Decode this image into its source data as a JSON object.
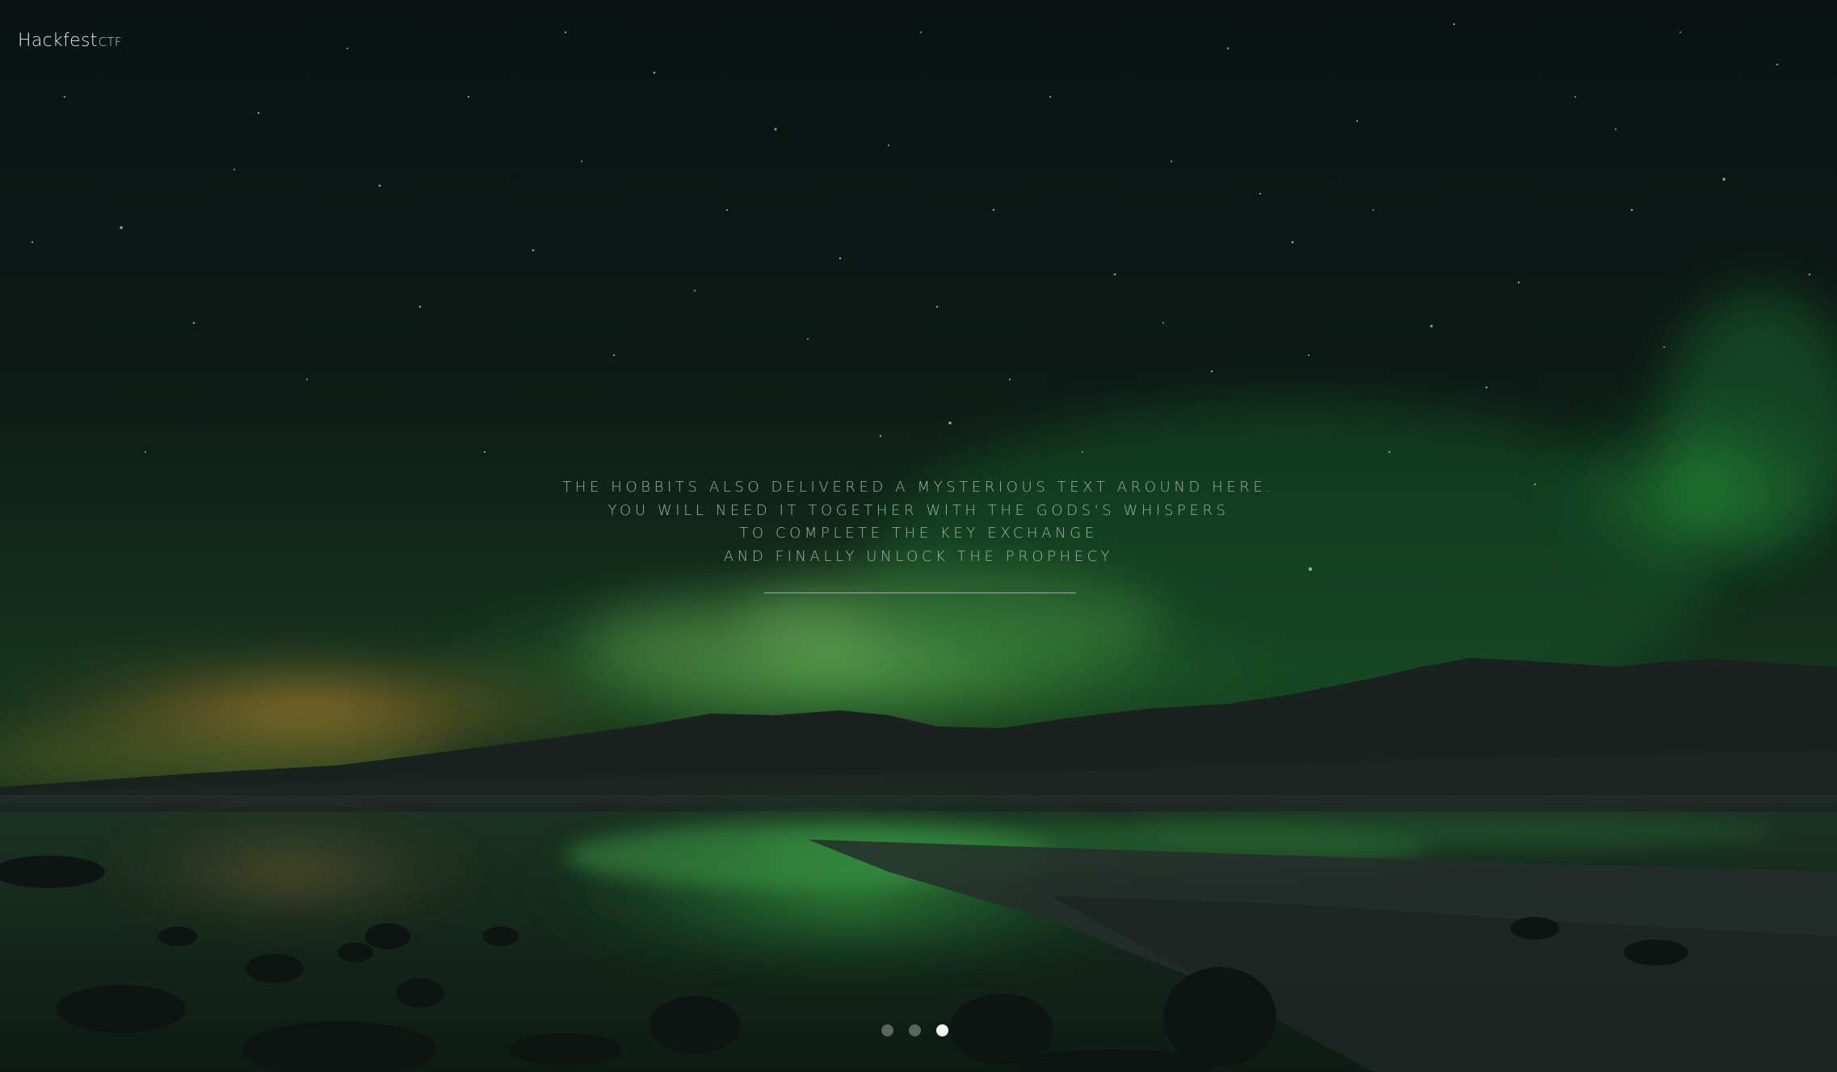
{
  "header": {
    "logo_main": "Hackfest",
    "logo_suffix": "CTF"
  },
  "message": {
    "lines": [
      "THE HOBBITS ALSO DELIVERED A MYSTERIOUS TEXT AROUND HERE.",
      "YOU WILL NEED IT TOGETHER WITH THE GODS'S WHISPERS",
      "TO COMPLETE THE KEY EXCHANGE",
      "AND FINALLY UNLOCK THE PROPHECY"
    ]
  },
  "slider": {
    "dot_count": 3,
    "active_index": 2
  },
  "background": {
    "description_icon": "aurora-night-landscape",
    "sky_color": "#0b1413",
    "aurora_color": "#3fbf4a",
    "glow_color": "#d99a36"
  }
}
